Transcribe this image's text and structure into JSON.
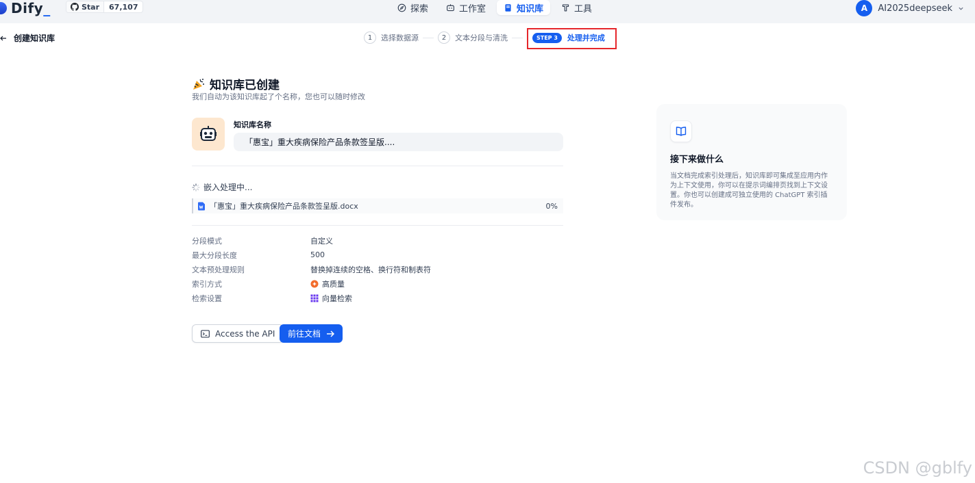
{
  "header": {
    "logo_text": "Dify",
    "github": {
      "star_label": "Star",
      "count": "67,107"
    },
    "nav": [
      {
        "label": "探索",
        "icon": "compass-icon"
      },
      {
        "label": "工作室",
        "icon": "robot-icon"
      },
      {
        "label": "知识库",
        "icon": "book-icon",
        "active": true
      },
      {
        "label": "工具",
        "icon": "hammer-icon"
      }
    ],
    "user": {
      "avatar_letter": "A",
      "name": "AI2025deepseek"
    }
  },
  "subheader": {
    "back_label": "创建知识库",
    "steps": [
      {
        "num": "1",
        "label": "选择数据源"
      },
      {
        "num": "2",
        "label": "文本分段与清洗"
      }
    ],
    "active_step": {
      "badge": "STEP 3",
      "label": "处理并完成"
    }
  },
  "main": {
    "title": "知识库已创建",
    "subtitle": "我们自动为该知识库起了个名称，您也可以随时修改",
    "name_label": "知识库名称",
    "name_value": "「惠宝」重大疾病保险产品条款签呈版....",
    "embed_status": "嵌入处理中...",
    "file": {
      "name": "「惠宝」重大疾病保险产品条款签呈版.docx",
      "progress": "0%"
    },
    "meta": [
      {
        "key": "分段模式",
        "value": "自定义"
      },
      {
        "key": "最大分段长度",
        "value": "500"
      },
      {
        "key": "文本预处理规则",
        "value": "替换掉连续的空格、换行符和制表符"
      },
      {
        "key": "索引方式",
        "value": "高质量",
        "icon": "orange-badge-icon"
      },
      {
        "key": "检索设置",
        "value": "向量检索",
        "icon": "grid-icon"
      }
    ],
    "buttons": {
      "api": "Access the API",
      "docs": "前往文档"
    }
  },
  "panel": {
    "title": "接下来做什么",
    "text": "当文档完成索引处理后，知识库即可集成至应用内作为上下文使用，你可以在提示词编排页找到上下文设置。你也可以创建成可独立使用的 ChatGPT 索引插件发布。"
  },
  "watermark": "CSDN @gblfy",
  "colors": {
    "primary": "#155eef",
    "highlight": "#e5262a"
  }
}
